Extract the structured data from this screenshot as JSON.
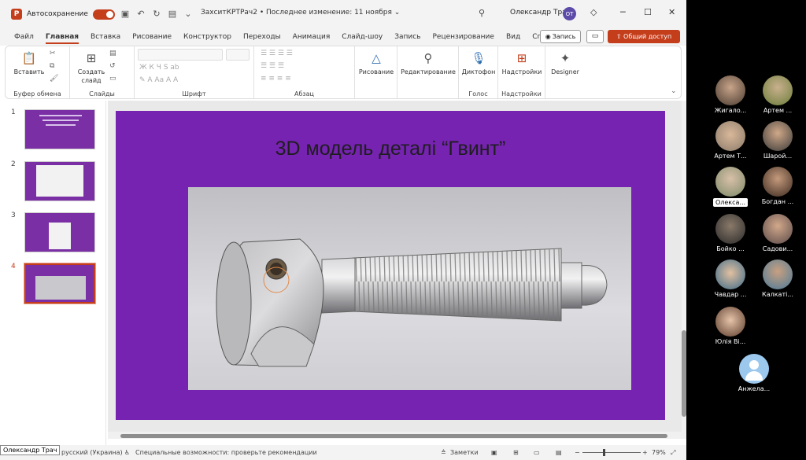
{
  "titlebar": {
    "autosave_label": "Автосохранение",
    "doc_title": "ЗахситКРТРач2 • Последнее изменение: 11 ноября ⌄",
    "user_name": "Олександр Трач",
    "user_initials": "ОТ"
  },
  "menu": {
    "items": [
      "Файл",
      "Главная",
      "Вставка",
      "Рисование",
      "Конструктор",
      "Переходы",
      "Анимация",
      "Слайд-шоу",
      "Запись",
      "Рецензирование",
      "Вид",
      "Справка"
    ],
    "record_label": "Запись",
    "share_label": "Общий доступ"
  },
  "ribbon": {
    "paste": "Вставить",
    "clipboard": "Буфер обмена",
    "new_slide_1": "Создать",
    "new_slide_2": "слайд",
    "slides": "Слайды",
    "font": "Шрифт",
    "paragraph": "Абзац",
    "drawing": "Рисование",
    "editing": "Редактирование",
    "dictate": "Диктофон",
    "voice": "Голос",
    "addins_btn": "Надстройки",
    "addins": "Надстройки",
    "designer": "Designer"
  },
  "thumbnails": [
    {
      "num": "1"
    },
    {
      "num": "2"
    },
    {
      "num": "3"
    },
    {
      "num": "4"
    }
  ],
  "slide": {
    "title": "3D модель деталі “Гвинт”"
  },
  "status": {
    "language": "русский (Украина)",
    "accessibility": "Специальные возможности: проверьте рекомендации",
    "notes": "Заметки",
    "zoom": "79%",
    "speaker": "Олександр Трач"
  },
  "participants": [
    {
      "name": "Жигало..."
    },
    {
      "name": "Артем ..."
    },
    {
      "name": "Артем Т..."
    },
    {
      "name": "Шарой..."
    },
    {
      "name": "Олекса..."
    },
    {
      "name": "Богдан ..."
    },
    {
      "name": "Бойко ..."
    },
    {
      "name": "Садови..."
    },
    {
      "name": "Чавдар ..."
    },
    {
      "name": "Калкаті..."
    },
    {
      "name": "Юлія Ві..."
    },
    {
      "name": "Анжела..."
    }
  ],
  "colors": {
    "accent": "#c43e1c",
    "slide_bg": "#7523b0"
  }
}
